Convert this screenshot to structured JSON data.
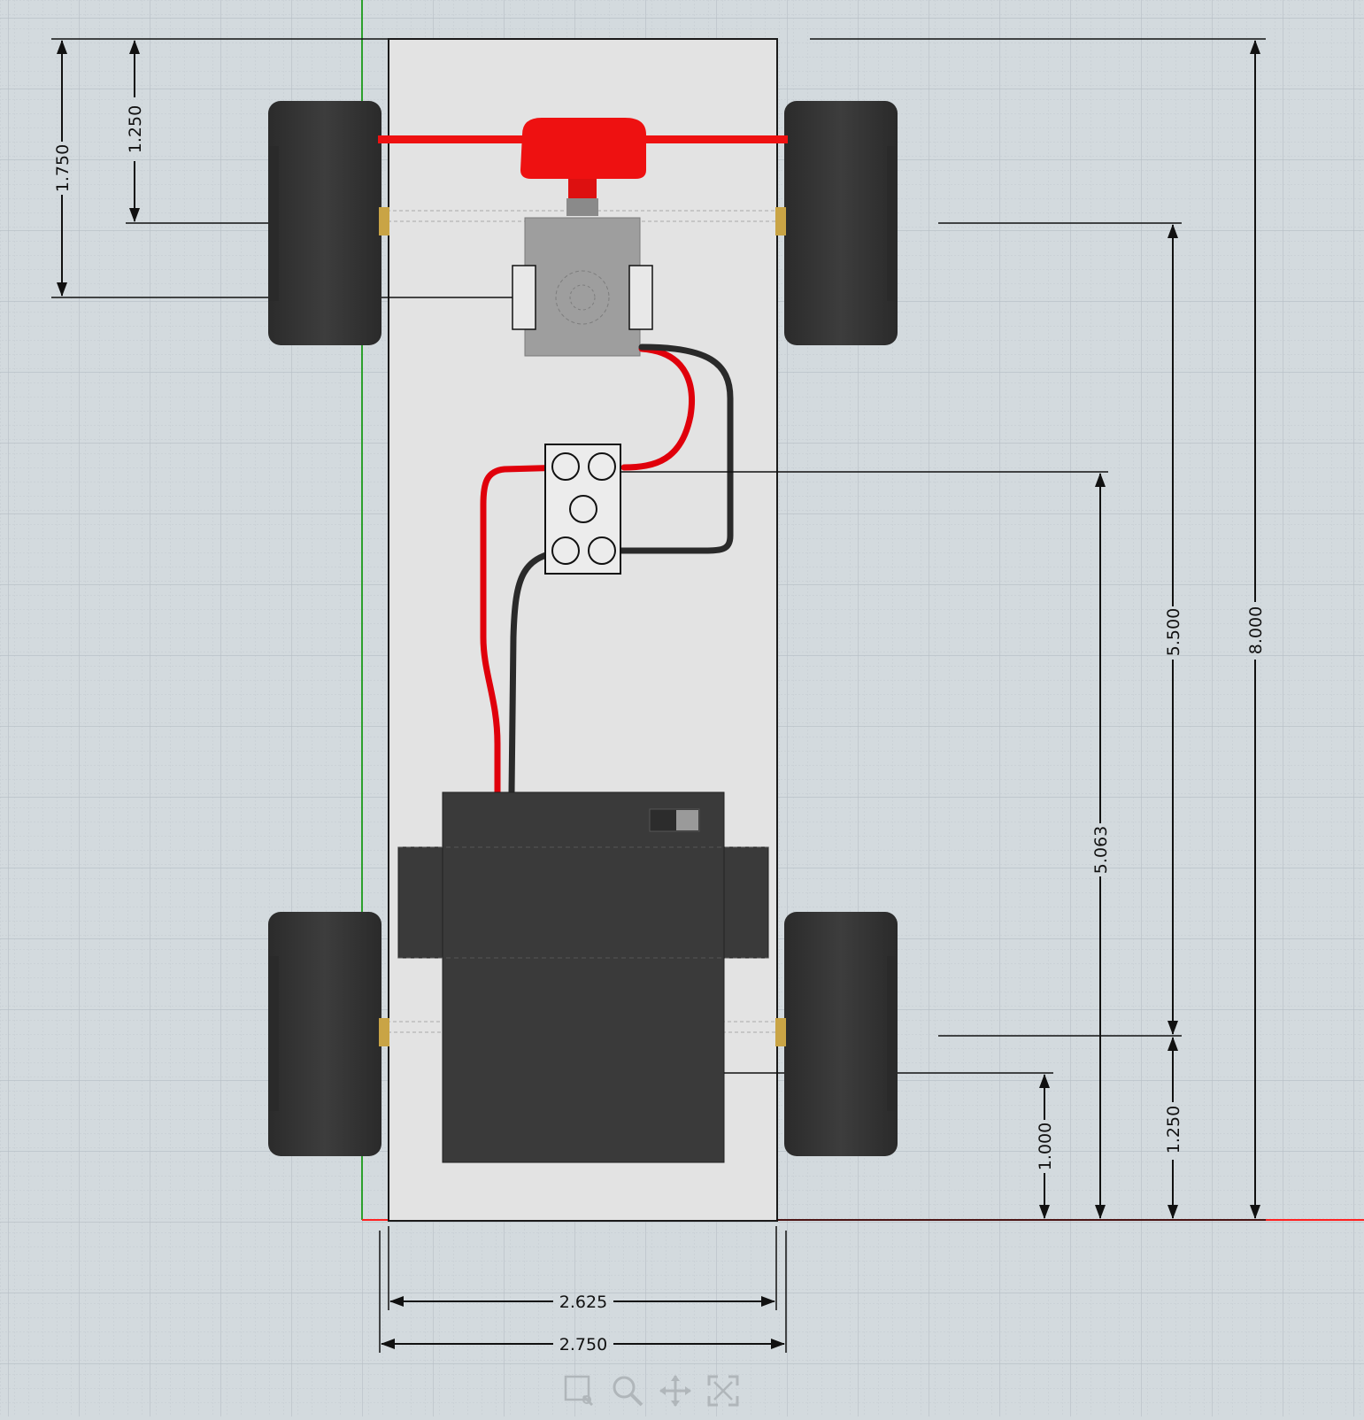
{
  "app": {
    "view": "Top view",
    "colors": {
      "background": "#d3dade",
      "grid_minor": "#c6ced3",
      "grid_major": "#b9c2c8",
      "axis_x": "#ff2020",
      "axis_y": "#2ca02c",
      "chassis": "#e2e2e2",
      "wheel": "#333333",
      "battery": "#3a3a3a",
      "servo": "#9a9a9a",
      "steering": "#ee1111",
      "wire_red": "#e0000b",
      "wire_black": "#2a2a2a",
      "axle_brass": "#c9a445"
    }
  },
  "dimensions": {
    "front_axle_from_top": "1.250",
    "servo_center_from_top": "1.750",
    "wheelbase": "5.500",
    "overall_length": "8.000",
    "terminal_from_bottom": "5.063",
    "rear_axle_from_bottom": "1.250",
    "battery_edge_from_bottom": "1.000",
    "inner_width": "2.625",
    "outer_width": "2.750"
  },
  "toolbar": [
    {
      "name": "select-box-icon"
    },
    {
      "name": "zoom-icon"
    },
    {
      "name": "pan-icon"
    },
    {
      "name": "fit-view-icon"
    }
  ]
}
